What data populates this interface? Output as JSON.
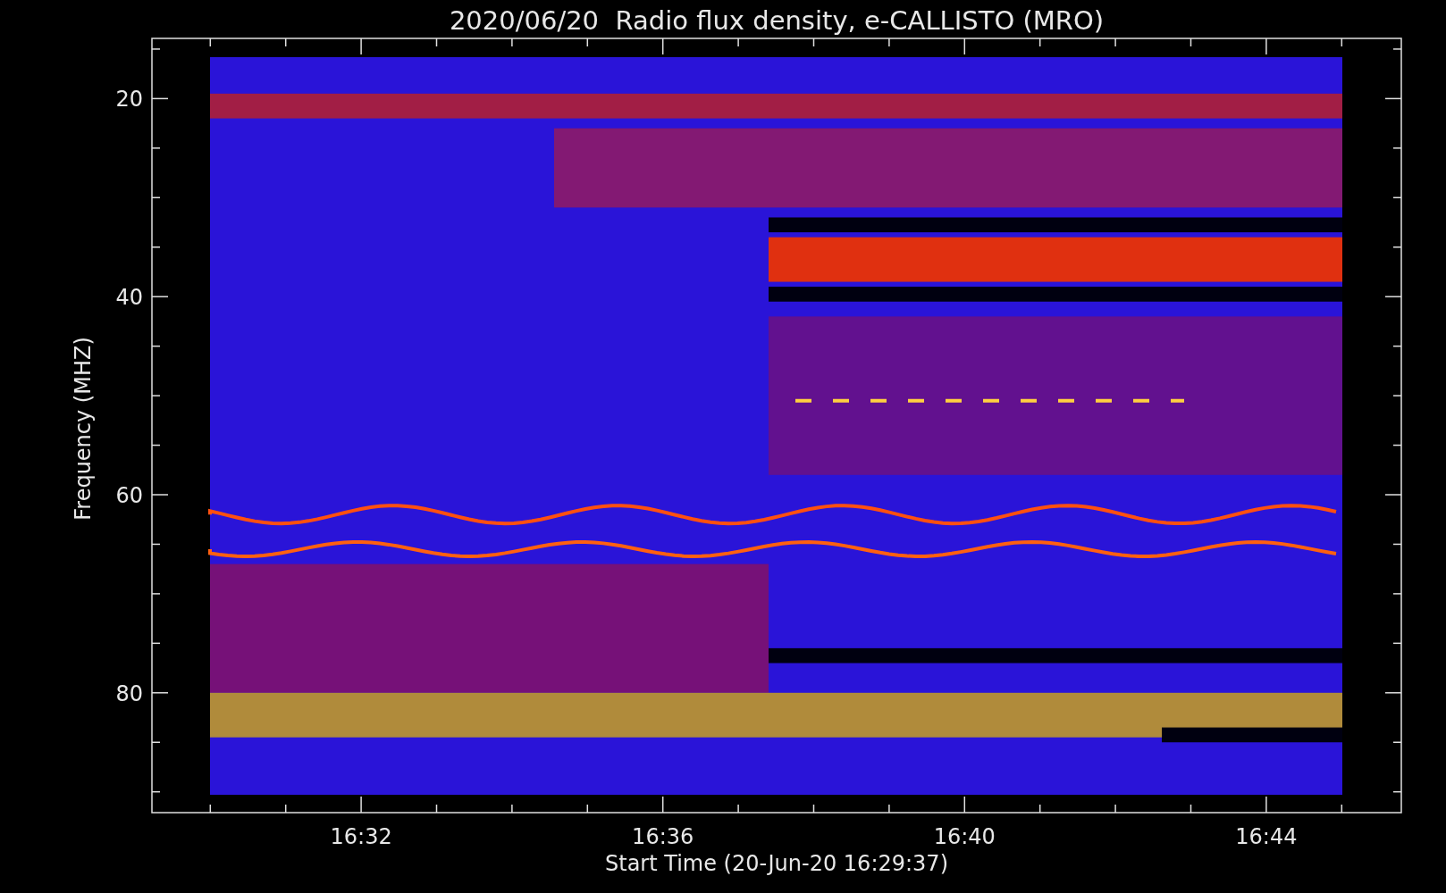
{
  "title": "2020/06/20  Radio flux density, e-CALLISTO (MRO)",
  "y_axis": {
    "label": "Frequency (MHZ)",
    "ticks": [
      "20",
      "40",
      "60",
      "80"
    ]
  },
  "x_axis": {
    "label": "Start Time (20-Jun-20 16:29:37)",
    "ticks": [
      "16:32",
      "16:36",
      "16:40",
      "16:44"
    ]
  }
}
